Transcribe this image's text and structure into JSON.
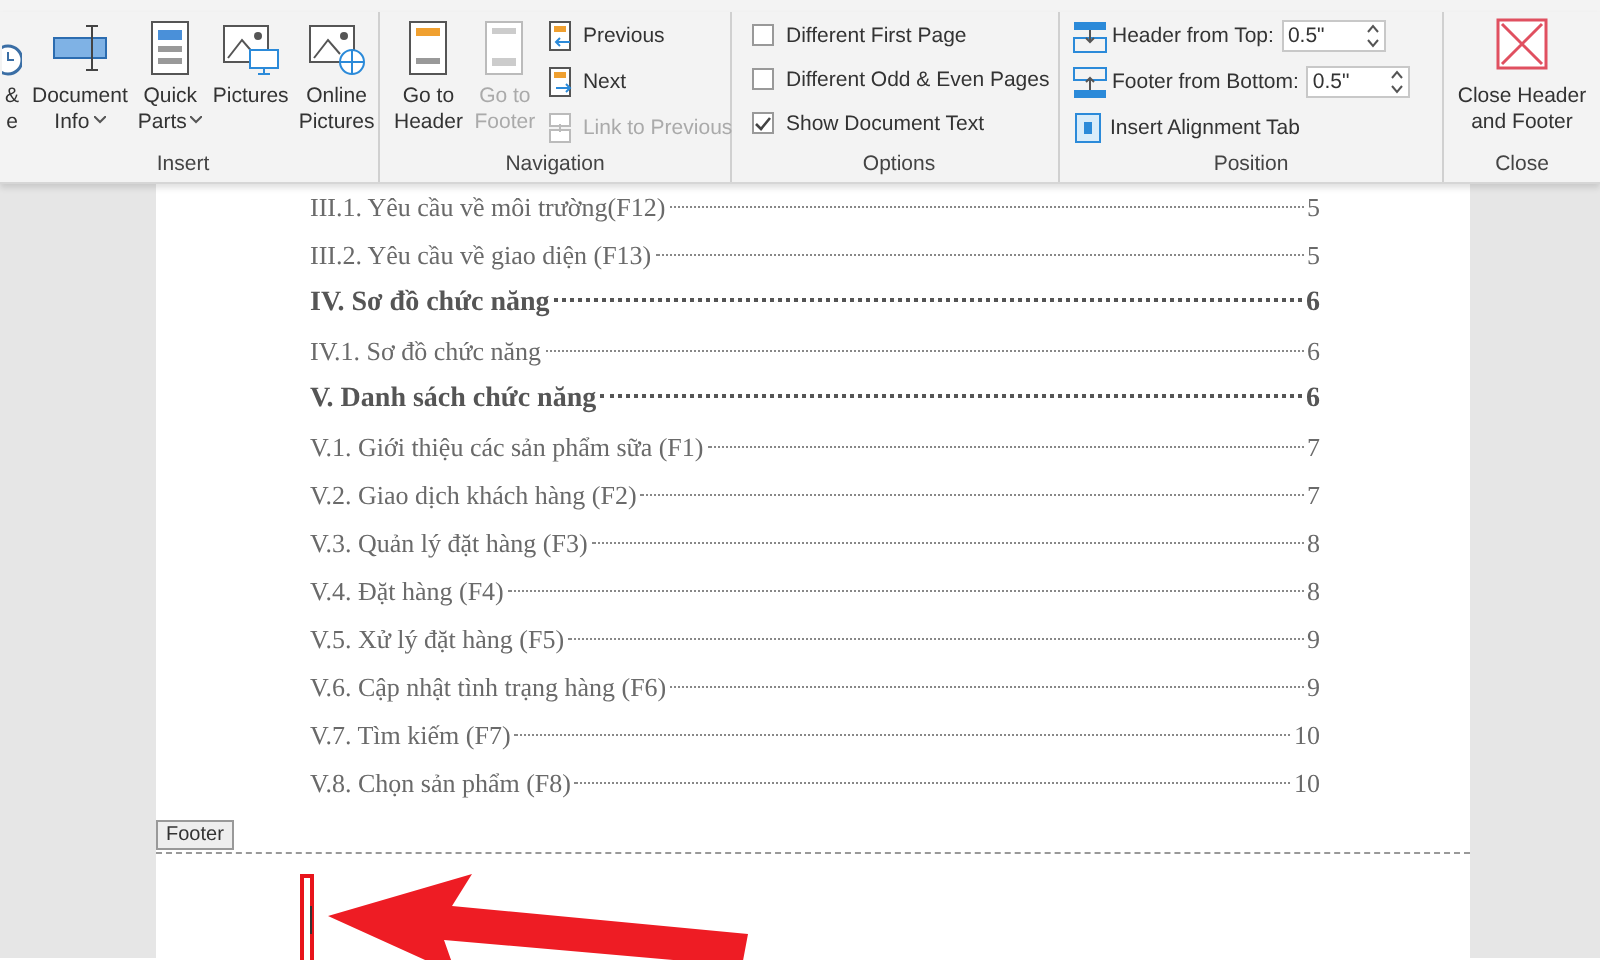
{
  "ribbon": {
    "groups": [
      {
        "label": "Insert",
        "items": [
          {
            "kind": "large",
            "lines": [
              "&",
              "e"
            ],
            "dropdown": false,
            "disabled": false
          },
          {
            "kind": "large",
            "lines": [
              "Document",
              "Info"
            ],
            "dropdown": true,
            "disabled": false
          },
          {
            "kind": "large",
            "lines": [
              "Quick",
              "Parts"
            ],
            "dropdown": true,
            "disabled": false
          },
          {
            "kind": "large",
            "lines": [
              "Pictures"
            ],
            "dropdown": false,
            "disabled": false
          },
          {
            "kind": "large",
            "lines": [
              "Online",
              "Pictures"
            ],
            "dropdown": false,
            "disabled": false
          }
        ]
      },
      {
        "label": "Navigation",
        "items": [
          {
            "kind": "large",
            "lines": [
              "Go to",
              "Header"
            ],
            "dropdown": false,
            "disabled": false
          },
          {
            "kind": "large",
            "lines": [
              "Go to",
              "Footer"
            ],
            "dropdown": false,
            "disabled": true
          },
          {
            "kind": "small",
            "label": "Previous",
            "disabled": false
          },
          {
            "kind": "small",
            "label": "Next",
            "disabled": false
          },
          {
            "kind": "small",
            "label": "Link to Previous",
            "disabled": true
          }
        ]
      },
      {
        "label": "Options",
        "items": [
          {
            "kind": "checkbox",
            "label": "Different First Page",
            "checked": false
          },
          {
            "kind": "checkbox",
            "label": "Different Odd & Even Pages",
            "checked": false
          },
          {
            "kind": "checkbox",
            "label": "Show Document Text",
            "checked": true
          }
        ]
      },
      {
        "label": "Position",
        "items": [
          {
            "kind": "spinner",
            "label": "Header from Top:",
            "value": "0.5\""
          },
          {
            "kind": "spinner",
            "label": "Footer from Bottom:",
            "value": "0.5\""
          },
          {
            "kind": "small",
            "label": "Insert Alignment Tab",
            "disabled": false
          }
        ]
      },
      {
        "label": "Close",
        "items": [
          {
            "kind": "large",
            "lines": [
              "Close Header",
              "and Footer"
            ],
            "dropdown": false,
            "disabled": false
          }
        ]
      }
    ]
  },
  "document": {
    "toc": [
      {
        "kind": "minor",
        "text": "III.1. Yêu cầu về môi trường(F12)",
        "page": "5"
      },
      {
        "kind": "minor",
        "text": "III.2. Yêu cầu về giao diện (F13)",
        "page": "5"
      },
      {
        "kind": "major",
        "text": "IV. Sơ đồ chức năng",
        "page": "6"
      },
      {
        "kind": "minor",
        "text": "IV.1. Sơ đồ chức năng",
        "page": "6"
      },
      {
        "kind": "major",
        "text": "V. Danh sách chức năng",
        "page": "6"
      },
      {
        "kind": "minor",
        "text": "V.1. Giới thiệu các sản phẩm sữa (F1)",
        "page": "7"
      },
      {
        "kind": "minor",
        "text": "V.2. Giao dịch khách hàng (F2)",
        "page": "7"
      },
      {
        "kind": "minor",
        "text": "V.3. Quản lý đặt hàng (F3)",
        "page": "8"
      },
      {
        "kind": "minor",
        "text": "V.4. Đặt hàng (F4)",
        "page": "8"
      },
      {
        "kind": "minor",
        "text": "V.5. Xử lý đặt hàng (F5)",
        "page": "9"
      },
      {
        "kind": "minor",
        "text": "V.6. Cập nhật tình trạng hàng (F6)",
        "page": "9"
      },
      {
        "kind": "minor",
        "text": "V.7. Tìm kiếm (F7)",
        "page": "10"
      },
      {
        "kind": "minor",
        "text": "V.8. Chọn sản phẩm (F8)",
        "page": "10"
      }
    ],
    "footer_tab": "Footer"
  }
}
